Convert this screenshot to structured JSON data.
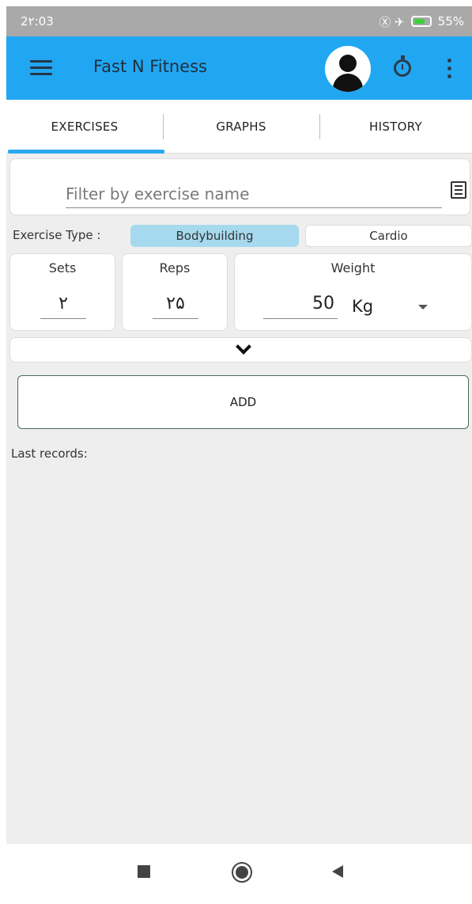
{
  "status_bar": {
    "time": "2۲:03",
    "icons": "Ⓧ ✈",
    "battery": "55%"
  },
  "app_bar": {
    "title": "Fast N Fitness",
    "menu_icon": "hamburger-icon",
    "avatar_icon": "person-icon",
    "timer_icon": "stopwatch-icon",
    "overflow_icon": "vertical-dots-icon",
    "color": "#21a7f2"
  },
  "tabs": [
    {
      "label": "EXERCISES",
      "selected": true
    },
    {
      "label": "GRAPHS",
      "selected": false
    },
    {
      "label": "HISTORY",
      "selected": false
    }
  ],
  "filter": {
    "placeholder": "Filter by exercise name",
    "value": ""
  },
  "exercise_type": {
    "label": "Exercise Type :",
    "options": [
      {
        "label": "Bodybuilding",
        "selected": true
      },
      {
        "label": "Cardio",
        "selected": false
      }
    ]
  },
  "fields": {
    "sets": {
      "label": "Sets",
      "value": "۲"
    },
    "reps": {
      "label": "Reps",
      "value": "۲۵"
    },
    "weight": {
      "label": "Weight",
      "value": "50",
      "unit": "Kg"
    }
  },
  "add_button": {
    "label": "ADD"
  },
  "last_records": {
    "label": "Last records:"
  },
  "nav_bar": {
    "recents_icon": "square-icon",
    "home_icon": "circle-icon",
    "back_icon": "triangle-back-icon"
  }
}
